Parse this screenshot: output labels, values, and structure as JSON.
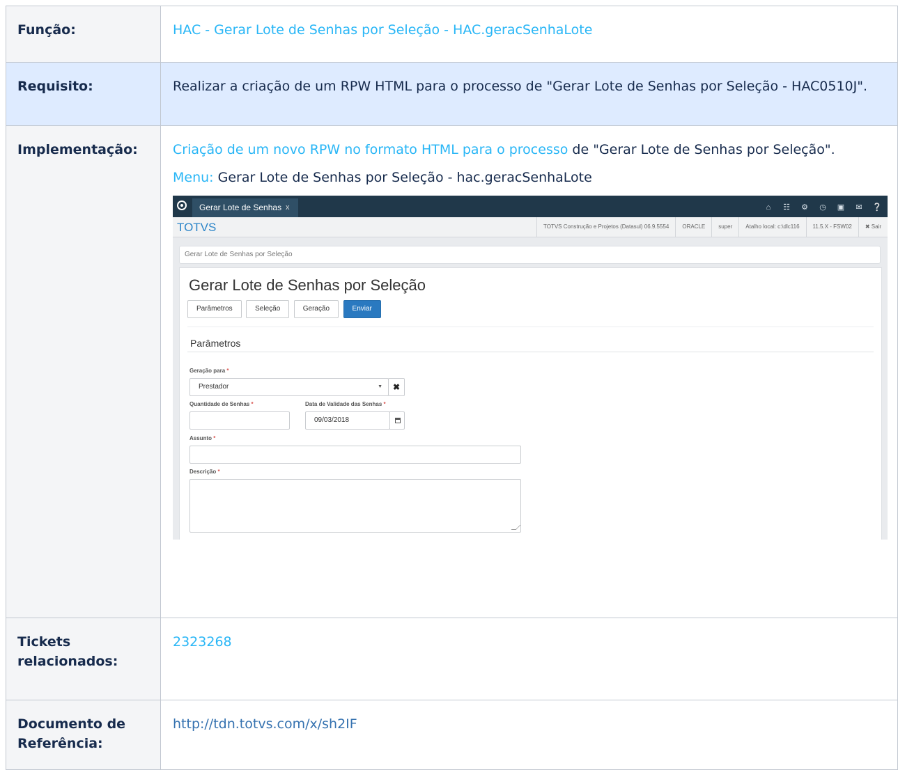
{
  "rows": {
    "funcao": {
      "label": "Função:",
      "value": "HAC - Gerar Lote de Senhas por Seleção - HAC.geracSenhaLote"
    },
    "requisito": {
      "label": "Requisito:",
      "value": "Realizar a criação de um RPW HTML para o processo de \"Gerar Lote de Senhas por Seleção - HAC0510J\"."
    },
    "implementacao": {
      "label": "Implementação:",
      "link_text": "Criação de um novo RPW no formato HTML para o processo",
      "rest_text": " de \"Gerar Lote de Senhas por Seleção\".",
      "menu_label": "Menu:",
      "menu_value": " Gerar Lote de Senhas por Seleção - hac.geracSenhaLote"
    },
    "tickets": {
      "label": "Tickets relacionados:",
      "value": "2323268"
    },
    "documento": {
      "label": "Documento de Referência:",
      "value": "http://tdn.totvs.com/x/sh2IF"
    }
  },
  "screenshot": {
    "tab_label": "Gerar Lote de Senhas",
    "tab_close": "x",
    "top_icons": [
      "home-icon",
      "sitemap-icon",
      "gear-icon",
      "clock-icon",
      "document-icon",
      "mail-icon",
      "help-icon"
    ],
    "brand": "TOTVS",
    "info": [
      "TOTVS Construção e Projetos (Datasul) 06.9.5554",
      "ORACLE",
      "super",
      "Atalho local: c:\\dlc116",
      "11.5.X - FSW02",
      "✖ Sair"
    ],
    "breadcrumb": "Gerar Lote de Senhas por Seleção",
    "title": "Gerar Lote de Senhas por Seleção",
    "buttons": {
      "parametros": "Parâmetros",
      "selecao": "Seleção",
      "geracao": "Geração",
      "enviar": "Enviar"
    },
    "section": "Parâmetros",
    "fields": {
      "geracao_label": "Geração para",
      "geracao_value": "Prestador",
      "quantidade_label": "Quantidade de Senhas",
      "quantidade_value": "",
      "data_label": "Data de Validade das Senhas",
      "data_value": "09/03/2018",
      "assunto_label": "Assunto",
      "assunto_value": "",
      "descricao_label": "Descrição",
      "descricao_value": "",
      "required_mark": "*"
    }
  }
}
